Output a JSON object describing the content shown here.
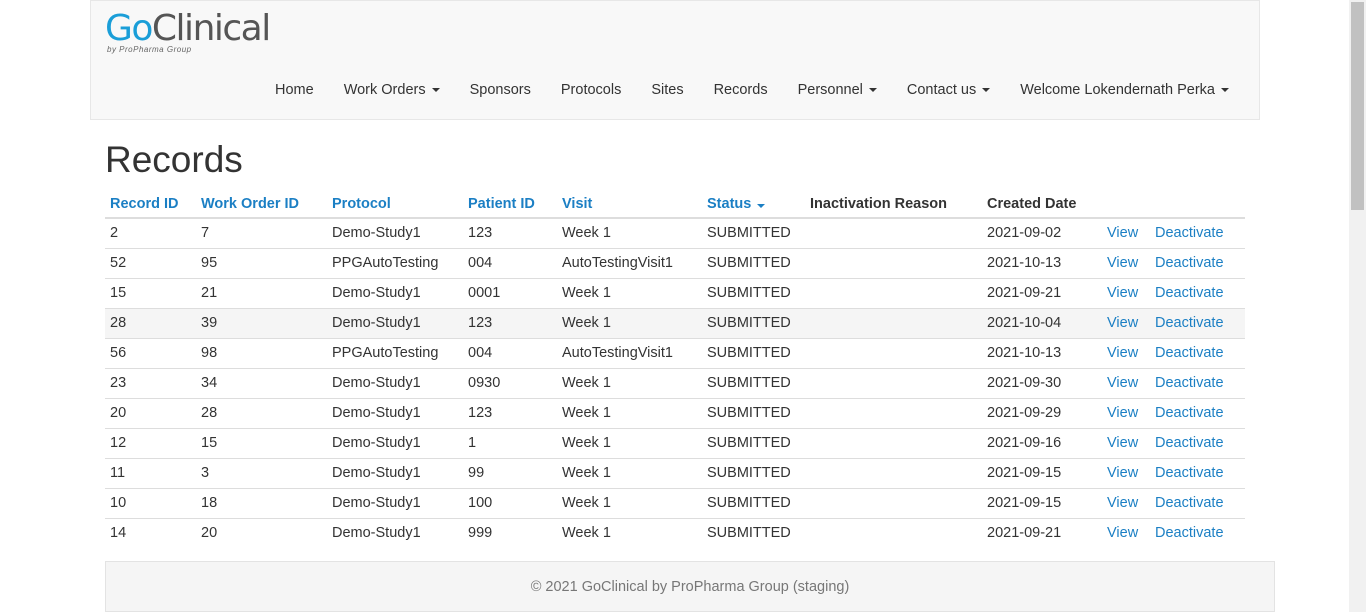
{
  "brand": {
    "logo_go": "Go",
    "logo_rest": "Clinical",
    "logo_sub": "by ProPharma Group"
  },
  "nav": {
    "home": "Home",
    "work_orders": "Work Orders",
    "sponsors": "Sponsors",
    "protocols": "Protocols",
    "sites": "Sites",
    "records": "Records",
    "personnel": "Personnel",
    "contact_us": "Contact us",
    "welcome": "Welcome Lokendernath Perka"
  },
  "page": {
    "title": "Records"
  },
  "table": {
    "headers": {
      "record_id": "Record ID",
      "work_order_id": "Work Order ID",
      "protocol": "Protocol",
      "patient_id": "Patient ID",
      "visit": "Visit",
      "status": "Status",
      "inactivation_reason": "Inactivation Reason",
      "created_date": "Created Date"
    },
    "view_label": "View",
    "deactivate_label": "Deactivate",
    "rows": [
      {
        "record_id": "2",
        "work_order_id": "7",
        "protocol": "Demo-Study1",
        "patient_id": "123",
        "visit": "Week 1",
        "status": "SUBMITTED",
        "inactivation_reason": "",
        "created_date": "2021-09-02"
      },
      {
        "record_id": "52",
        "work_order_id": "95",
        "protocol": "PPGAutoTesting",
        "patient_id": "004",
        "visit": "AutoTestingVisit1",
        "status": "SUBMITTED",
        "inactivation_reason": "",
        "created_date": "2021-10-13"
      },
      {
        "record_id": "15",
        "work_order_id": "21",
        "protocol": "Demo-Study1",
        "patient_id": "0001",
        "visit": "Week 1",
        "status": "SUBMITTED",
        "inactivation_reason": "",
        "created_date": "2021-09-21"
      },
      {
        "record_id": "28",
        "work_order_id": "39",
        "protocol": "Demo-Study1",
        "patient_id": "123",
        "visit": "Week 1",
        "status": "SUBMITTED",
        "inactivation_reason": "",
        "created_date": "2021-10-04"
      },
      {
        "record_id": "56",
        "work_order_id": "98",
        "protocol": "PPGAutoTesting",
        "patient_id": "004",
        "visit": "AutoTestingVisit1",
        "status": "SUBMITTED",
        "inactivation_reason": "",
        "created_date": "2021-10-13"
      },
      {
        "record_id": "23",
        "work_order_id": "34",
        "protocol": "Demo-Study1",
        "patient_id": "0930",
        "visit": "Week 1",
        "status": "SUBMITTED",
        "inactivation_reason": "",
        "created_date": "2021-09-30"
      },
      {
        "record_id": "20",
        "work_order_id": "28",
        "protocol": "Demo-Study1",
        "patient_id": "123",
        "visit": "Week 1",
        "status": "SUBMITTED",
        "inactivation_reason": "",
        "created_date": "2021-09-29"
      },
      {
        "record_id": "12",
        "work_order_id": "15",
        "protocol": "Demo-Study1",
        "patient_id": "1",
        "visit": "Week 1",
        "status": "SUBMITTED",
        "inactivation_reason": "",
        "created_date": "2021-09-16"
      },
      {
        "record_id": "11",
        "work_order_id": "3",
        "protocol": "Demo-Study1",
        "patient_id": "99",
        "visit": "Week 1",
        "status": "SUBMITTED",
        "inactivation_reason": "",
        "created_date": "2021-09-15"
      },
      {
        "record_id": "10",
        "work_order_id": "18",
        "protocol": "Demo-Study1",
        "patient_id": "100",
        "visit": "Week 1",
        "status": "SUBMITTED",
        "inactivation_reason": "",
        "created_date": "2021-09-15"
      },
      {
        "record_id": "14",
        "work_order_id": "20",
        "protocol": "Demo-Study1",
        "patient_id": "999",
        "visit": "Week 1",
        "status": "SUBMITTED",
        "inactivation_reason": "",
        "created_date": "2021-09-21"
      }
    ]
  },
  "footer": {
    "text": "© 2021 GoClinical by ProPharma Group (staging)"
  }
}
